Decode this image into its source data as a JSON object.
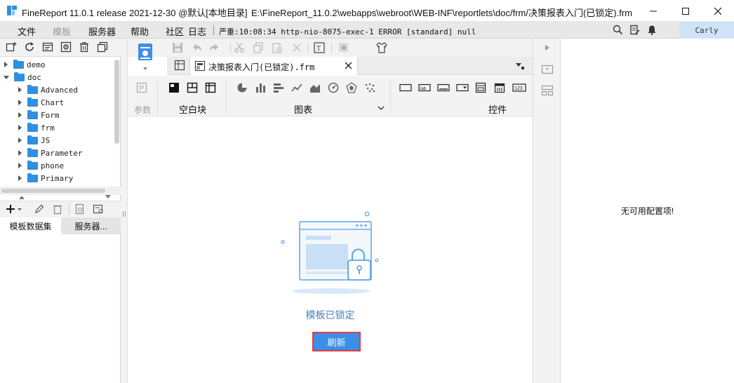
{
  "titlebar": {
    "title": "FineReport 11.0.1 release 2021-12-30 @默认[本地目录]",
    "path": "E:\\FineReport_11.0.2\\webapps\\webroot\\WEB-INF\\reportlets\\doc/frm/决策报表入门(已锁定).frm"
  },
  "menu": {
    "file": "文件",
    "template": "模板",
    "server": "服务器",
    "help": "帮助",
    "community": "社区",
    "log": "日志",
    "status": "严重:10:08:34 http-nio-8075-exec-1 ERROR [standard] null"
  },
  "user": {
    "name": "Carly"
  },
  "tree": {
    "items": [
      {
        "label": "demo",
        "level": 0,
        "expanded": false
      },
      {
        "label": "doc",
        "level": 0,
        "expanded": true
      },
      {
        "label": "Advanced",
        "level": 1,
        "expanded": false
      },
      {
        "label": "Chart",
        "level": 1,
        "expanded": false
      },
      {
        "label": "Form",
        "level": 1,
        "expanded": false
      },
      {
        "label": "frm",
        "level": 1,
        "expanded": false
      },
      {
        "label": "JS",
        "level": 1,
        "expanded": false
      },
      {
        "label": "Parameter",
        "level": 1,
        "expanded": false
      },
      {
        "label": "phone",
        "level": 1,
        "expanded": false
      },
      {
        "label": "Primary",
        "level": 1,
        "expanded": false
      }
    ]
  },
  "left_tabs": {
    "dataset": "模板数据集",
    "server": "服务器..."
  },
  "doc_tab": {
    "label": "决策报表入门(已锁定).frm"
  },
  "widget_bar": {
    "param": "参数",
    "blank_block": "空白块",
    "chart": "图表",
    "control": "控件"
  },
  "canvas": {
    "locked_msg": "模板已锁定",
    "refresh_label": "刷新"
  },
  "right_panel": {
    "no_config": "无可用配置项!"
  },
  "colors": {
    "accent": "#3d8ee6",
    "folder": "#2f8fe0",
    "highlight_border": "#e33d3d",
    "user_bg": "#cfe3f7"
  }
}
